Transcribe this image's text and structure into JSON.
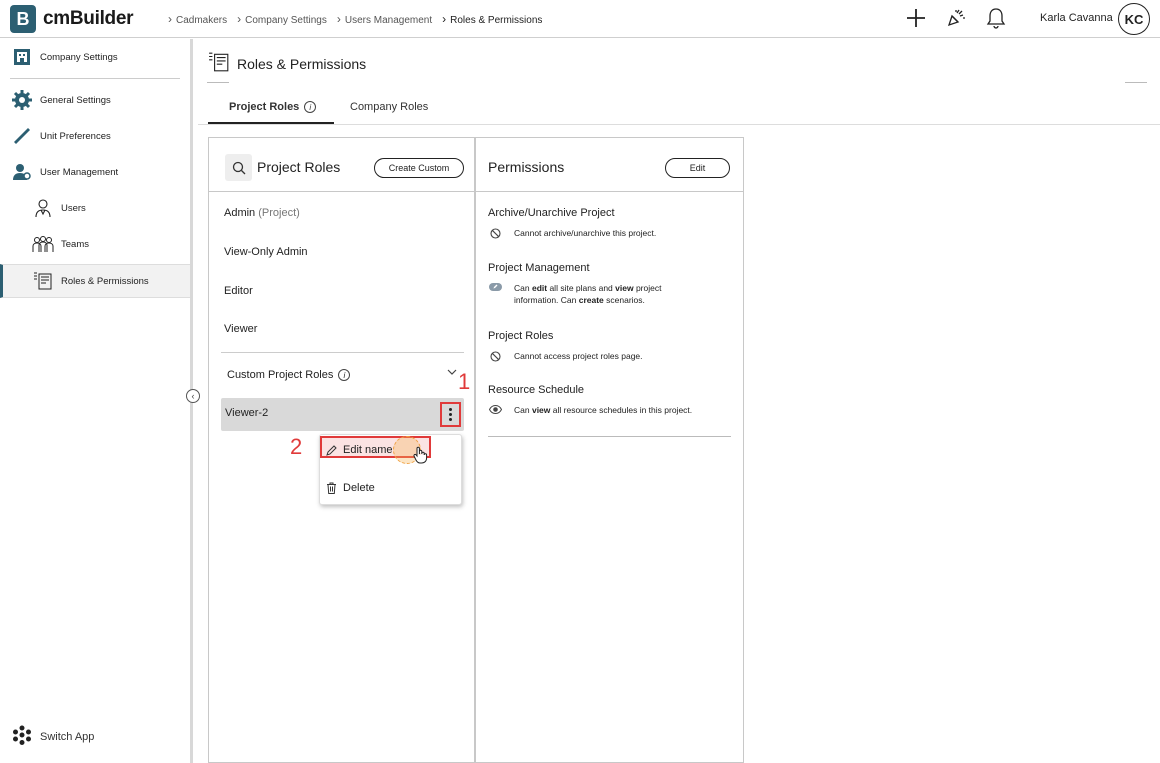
{
  "app": {
    "logo_letter": "B",
    "name": "cmBuilder"
  },
  "breadcrumb": [
    "Cadmakers",
    "Company Settings",
    "Users Management",
    "Roles & Permissions"
  ],
  "user": {
    "name": "Karla Cavanna",
    "initials": "KC"
  },
  "sidebar": {
    "items": [
      {
        "label": "Company Settings",
        "icon": "building-icon"
      },
      {
        "label": "General Settings",
        "icon": "gear-icon"
      },
      {
        "label": "Unit Preferences",
        "icon": "ruler-icon"
      },
      {
        "label": "User Management",
        "icon": "users-manage-icon"
      },
      {
        "label": "Users",
        "icon": "user-icon"
      },
      {
        "label": "Teams",
        "icon": "team-icon"
      },
      {
        "label": "Roles & Permissions",
        "icon": "roles-icon"
      }
    ],
    "switch_app": "Switch App"
  },
  "page": {
    "title": "Roles & Permissions",
    "tabs": [
      "Project Roles",
      "Company Roles"
    ]
  },
  "roles_panel": {
    "title": "Project Roles",
    "create_button": "Create Custom",
    "roles": [
      {
        "name": "Admin",
        "suffix": "(Project)"
      },
      {
        "name": "View-Only Admin",
        "suffix": ""
      },
      {
        "name": "Editor",
        "suffix": ""
      },
      {
        "name": "Viewer",
        "suffix": ""
      }
    ],
    "custom_heading": "Custom Project Roles",
    "custom_roles": [
      "Viewer-2"
    ],
    "context_menu": {
      "edit": "Edit name",
      "delete": "Delete"
    },
    "step_labels": [
      "1",
      "2"
    ]
  },
  "permissions_panel": {
    "title": "Permissions",
    "edit_button": "Edit",
    "items": [
      {
        "title": "Archive/Unarchive Project",
        "icon": "ban-icon",
        "desc": "Cannot archive/unarchive this project."
      },
      {
        "title": "Project Management",
        "icon": "edit-badge-icon",
        "desc_parts": [
          "Can ",
          "edit",
          " all site plans and ",
          "view",
          " project information. Can ",
          "create",
          " scenarios."
        ]
      },
      {
        "title": "Project Roles",
        "icon": "ban-icon",
        "desc": "Cannot access project roles page."
      },
      {
        "title": "Resource Schedule",
        "icon": "eye-icon",
        "desc_parts": [
          "Can ",
          "view",
          " all resource schedules in this project."
        ]
      }
    ]
  },
  "colors": {
    "brand": "#2c5f72",
    "annotation": "#e03a3a"
  }
}
